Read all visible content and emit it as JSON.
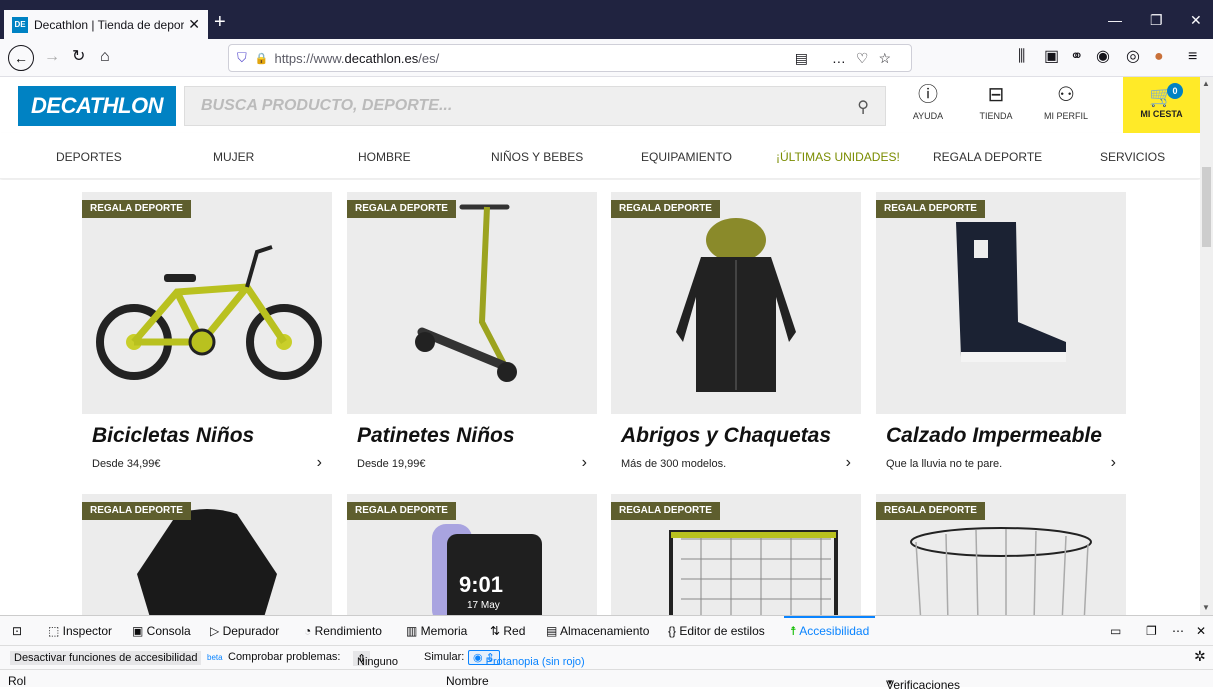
{
  "browser": {
    "tab_title": "Decathlon | Tienda de deportes",
    "favicon_text": "DE",
    "url_prefix": "https://www.",
    "url_host": "decathlon.es",
    "url_path": "/es/"
  },
  "site": {
    "logo": "DECATHLON",
    "search_placeholder": "BUSCA PRODUCTO, DEPORTE...",
    "header_links": [
      {
        "label": "AYUDA",
        "icon": "help-icon"
      },
      {
        "label": "TIENDA",
        "icon": "store-icon"
      },
      {
        "label": "MI PERFIL",
        "icon": "user-icon"
      }
    ],
    "cart_label": "MI CESTA",
    "cart_count": "0",
    "nav": [
      "DEPORTES",
      "MUJER",
      "HOMBRE",
      "NIÑOS Y BEBES",
      "EQUIPAMIENTO",
      "¡ÚLTIMAS UNIDADES!",
      "REGALA DEPORTE",
      "SERVICIOS"
    ],
    "accent": "#0082c3",
    "cart_color": "#ffea28"
  },
  "products": [
    {
      "tag": "REGALA DEPORTE",
      "title": "Bicicletas Niños",
      "subtitle": "Desde 34,99€"
    },
    {
      "tag": "REGALA DEPORTE",
      "title": "Patinetes Niños",
      "subtitle": "Desde 19,99€"
    },
    {
      "tag": "REGALA DEPORTE",
      "title": "Abrigos y Chaquetas",
      "subtitle": "Más de 300 modelos."
    },
    {
      "tag": "REGALA DEPORTE",
      "title": "Calzado Impermeable",
      "subtitle": "Que la lluvia no te pare."
    }
  ],
  "products_row2": [
    {
      "tag": "REGALA DEPORTE"
    },
    {
      "tag": "REGALA DEPORTE",
      "watch_time": "9:01",
      "watch_date": "17 May"
    },
    {
      "tag": "REGALA DEPORTE"
    },
    {
      "tag": "REGALA DEPORTE"
    }
  ],
  "devtools": {
    "tabs": [
      "Inspector",
      "Consola",
      "Depurador",
      "Rendimiento",
      "Memoria",
      "Red",
      "Almacenamiento",
      "Editor de estilos",
      "Accesibilidad"
    ],
    "disable_btn": "Desactivar funciones de accesibilidad",
    "beta": "beta",
    "check_label": "Comprobar problemas:",
    "check_value": "Ninguno",
    "simulate_label": "Simular:",
    "simulate_value": "Protanopia (sin rojo)",
    "col_role": "Rol",
    "col_name": "Nombre",
    "col_checks": "Verificaciones"
  }
}
